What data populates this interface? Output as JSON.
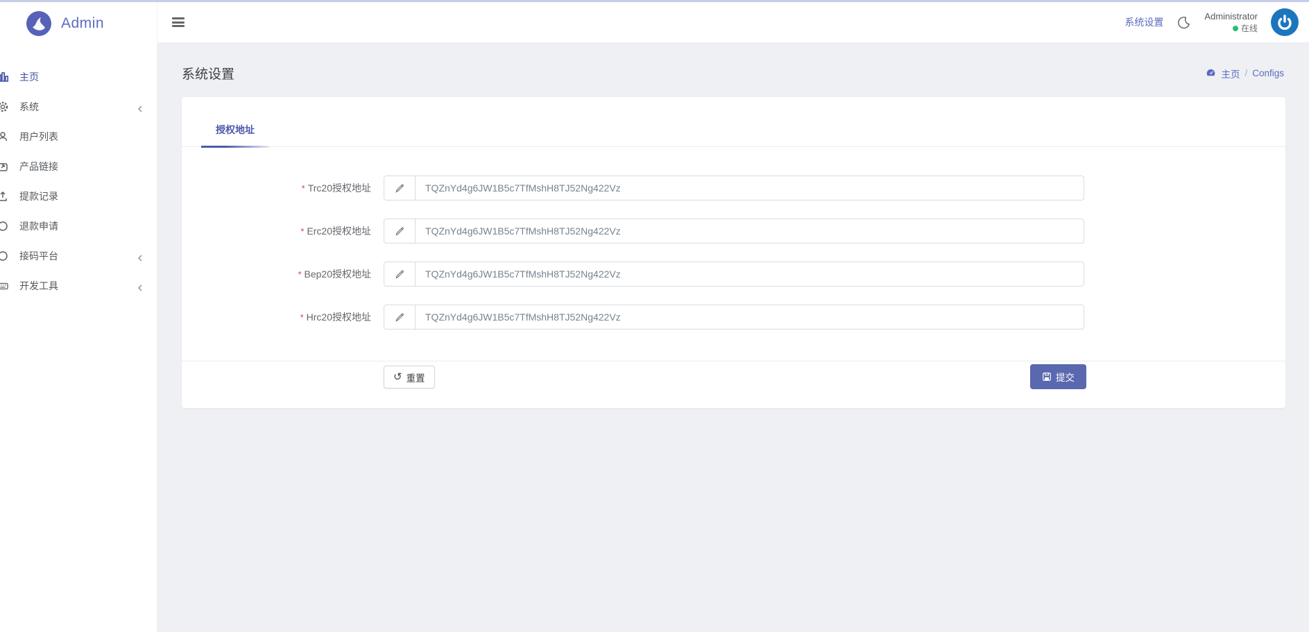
{
  "brand": {
    "name": "Admin"
  },
  "topbar": {
    "settings_link": "系统设置",
    "user": {
      "name": "Administrator",
      "status": "在线"
    }
  },
  "sidebar": {
    "items": [
      {
        "label": "主页"
      },
      {
        "label": "系统"
      },
      {
        "label": "用户列表"
      },
      {
        "label": "产品链接"
      },
      {
        "label": "提款记录"
      },
      {
        "label": "退款申请"
      },
      {
        "label": "接码平台"
      },
      {
        "label": "开发工具"
      }
    ]
  },
  "page": {
    "title": "系统设置",
    "breadcrumb": {
      "home": "主页",
      "separator": "/",
      "current": "Configs"
    }
  },
  "form": {
    "tab_label": "授权地址",
    "fields": [
      {
        "required_mark": "*",
        "label": "Trc20授权地址",
        "value": "TQZnYd4g6JW1B5c7TfMshH8TJ52Ng422Vz"
      },
      {
        "required_mark": "*",
        "label": "Erc20授权地址",
        "value": "TQZnYd4g6JW1B5c7TfMshH8TJ52Ng422Vz"
      },
      {
        "required_mark": "*",
        "label": "Bep20授权地址",
        "value": "TQZnYd4g6JW1B5c7TfMshH8TJ52Ng422Vz"
      },
      {
        "required_mark": "*",
        "label": "Hrc20授权地址",
        "value": "TQZnYd4g6JW1B5c7TfMshH8TJ52Ng422Vz"
      }
    ],
    "reset_icon_glyph": "↺",
    "reset_label": "重置",
    "submit_label": "提交"
  },
  "colors": {
    "accent": "#5c6bc0",
    "active_item": "#3f4fa5",
    "submit_button": "#5a68af",
    "avatar_blue": "#1d76bd",
    "online_green": "#2bbb72",
    "top_strip": "#c5cde9"
  }
}
